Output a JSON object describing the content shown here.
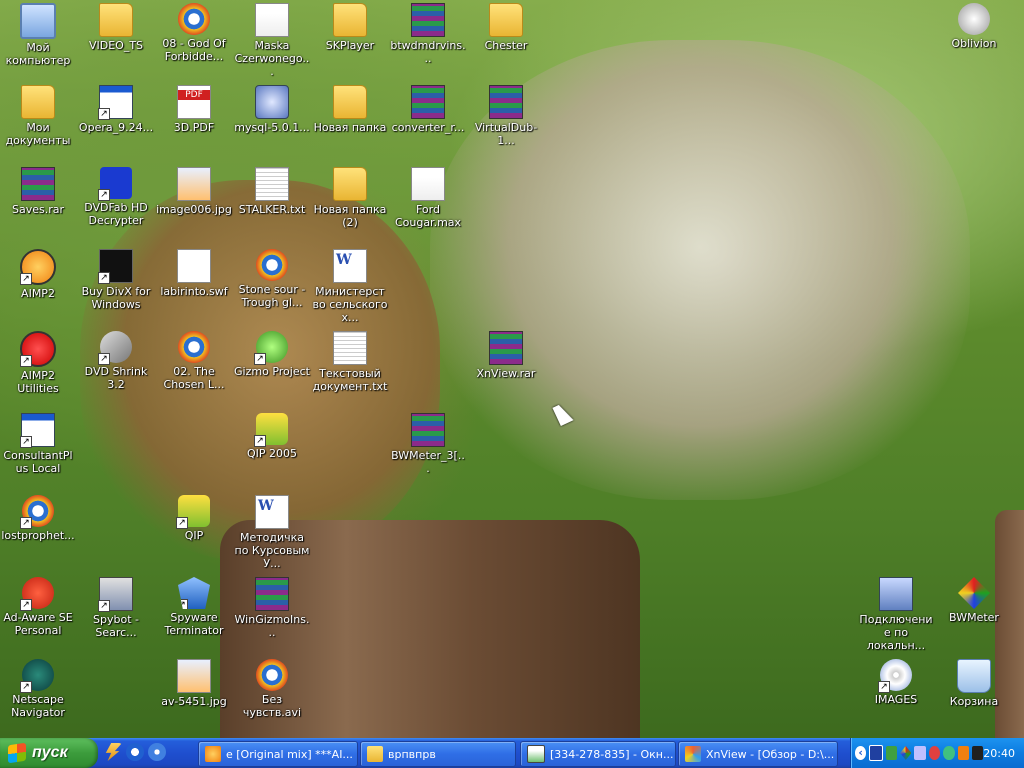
{
  "desktop": {
    "icons": [
      {
        "label": "Мой компьютер",
        "glyph": "g-computer",
        "icon": "my-computer-icon"
      },
      {
        "label": "VIDEO_TS",
        "glyph": "g-folder",
        "icon": "folder-icon"
      },
      {
        "label": "08 - God Of Forbidde...",
        "glyph": "g-media",
        "icon": "media-file-icon"
      },
      {
        "label": "Maska Czerwonego...",
        "glyph": "g-max",
        "icon": "max-file-icon"
      },
      {
        "label": "SKPlayer",
        "glyph": "g-folder",
        "icon": "folder-icon"
      },
      {
        "label": "btwdmdrvins...",
        "glyph": "g-rar",
        "icon": "rar-archive-icon"
      },
      {
        "label": "Chester",
        "glyph": "g-folder",
        "icon": "folder-icon"
      },
      {
        "label": "Oblivion",
        "glyph": "g-oblivion",
        "icon": "oblivion-game-icon"
      },
      {
        "label": "Мои документы",
        "glyph": "g-folder-doc",
        "icon": "my-documents-icon"
      },
      {
        "label": "Opera_9.24...",
        "glyph": "g-window",
        "icon": "application-icon"
      },
      {
        "label": "3D.PDF",
        "glyph": "g-pdf",
        "icon": "pdf-file-icon"
      },
      {
        "label": "mysql-5.0.1...",
        "glyph": "g-setup",
        "icon": "installer-icon"
      },
      {
        "label": "Новая папка",
        "glyph": "g-folder",
        "icon": "folder-icon"
      },
      {
        "label": "converter_r...",
        "glyph": "g-rar",
        "icon": "rar-archive-icon"
      },
      {
        "label": "VirtualDub-1...",
        "glyph": "g-rar",
        "icon": "rar-archive-icon"
      },
      {
        "label": "Saves.rar",
        "glyph": "g-rar",
        "icon": "rar-archive-icon"
      },
      {
        "label": "DVDFab HD Decrypter",
        "glyph": "g-dvdfab",
        "icon": "dvdfab-icon"
      },
      {
        "label": "image006.jpg",
        "glyph": "g-img",
        "icon": "image-file-icon"
      },
      {
        "label": "STALKER.txt",
        "glyph": "g-txt",
        "icon": "text-file-icon"
      },
      {
        "label": "Новая папка (2)",
        "glyph": "g-folder",
        "icon": "folder-icon"
      },
      {
        "label": "Ford Cougar.max",
        "glyph": "g-max",
        "icon": "max-file-icon"
      },
      {
        "label": "AIMP2",
        "glyph": "g-aimp",
        "icon": "aimp-icon"
      },
      {
        "label": "Buy DivX for Windows",
        "glyph": "g-divx",
        "icon": "divx-icon"
      },
      {
        "label": "labirinto.swf",
        "glyph": "g-swf",
        "icon": "swf-file-icon"
      },
      {
        "label": "Stone sour - Trough gl...",
        "glyph": "g-media",
        "icon": "media-file-icon"
      },
      {
        "label": "Министерство сельского х...",
        "glyph": "g-word",
        "icon": "word-document-icon"
      },
      {
        "label": "AIMP2 Utilities",
        "glyph": "g-aimpu",
        "icon": "aimp-utilities-icon"
      },
      {
        "label": "DVD Shrink 3.2",
        "glyph": "g-shrink",
        "icon": "dvd-shrink-icon"
      },
      {
        "label": "02. The Chosen L...",
        "glyph": "g-media",
        "icon": "media-file-icon"
      },
      {
        "label": "Gizmo Project",
        "glyph": "g-gizmo",
        "icon": "gizmo-icon"
      },
      {
        "label": "Текстовый документ.txt",
        "glyph": "g-txt",
        "icon": "text-file-icon"
      },
      {
        "label": "XnView.rar",
        "glyph": "g-rar",
        "icon": "rar-archive-icon"
      },
      {
        "label": "ConsultantPlus Local",
        "glyph": "g-window",
        "icon": "application-icon"
      },
      {
        "label": "QIP 2005",
        "glyph": "g-qip",
        "icon": "qip-icon"
      },
      {
        "label": "BWMeter_3[...",
        "glyph": "g-rar",
        "icon": "rar-archive-icon"
      },
      {
        "label": "lostprophet...",
        "glyph": "g-media",
        "icon": "media-file-icon"
      },
      {
        "label": "QIP",
        "glyph": "g-qip",
        "icon": "qip-icon"
      },
      {
        "label": "Методичка по Курсовым У...",
        "glyph": "g-word",
        "icon": "word-document-icon"
      },
      {
        "label": "Ad-Aware SE Personal",
        "glyph": "g-adaware",
        "icon": "ad-aware-icon"
      },
      {
        "label": "Spybot - Searc...",
        "glyph": "g-spybot",
        "icon": "spybot-icon"
      },
      {
        "label": "Spyware Terminator",
        "glyph": "g-spyware",
        "icon": "spyware-terminator-icon"
      },
      {
        "label": "WinGizmoIns...",
        "glyph": "g-rar",
        "icon": "rar-archive-icon"
      },
      {
        "label": "Подключение по локальн...",
        "glyph": "g-network",
        "icon": "network-connection-icon"
      },
      {
        "label": "BWMeter",
        "glyph": "g-bwmeter",
        "icon": "bwmeter-icon"
      },
      {
        "label": "Netscape Navigator",
        "glyph": "g-netscape",
        "icon": "netscape-icon"
      },
      {
        "label": "av-5451.jpg",
        "glyph": "g-img",
        "icon": "image-file-icon"
      },
      {
        "label": "Без чувств.avi",
        "glyph": "g-media",
        "icon": "video-file-icon"
      },
      {
        "label": "IMAGES",
        "glyph": "g-cd",
        "icon": "cd-images-icon"
      },
      {
        "label": "Корзина",
        "glyph": "g-bin",
        "icon": "recycle-bin-icon"
      }
    ]
  },
  "taskbar": {
    "start_label": "пуск",
    "buttons": [
      {
        "label": "e [Original mix] ***AI...",
        "icon": "tb-aimp"
      },
      {
        "label": "врпвпрв",
        "icon": "tb-folder"
      },
      {
        "label": "[334-278-835] - Окн...",
        "icon": "tb-note"
      },
      {
        "label": "XnView - [Обзор - D:\\...",
        "icon": "tb-xn"
      }
    ],
    "tray_expand": "‹",
    "clock": "20:40"
  }
}
